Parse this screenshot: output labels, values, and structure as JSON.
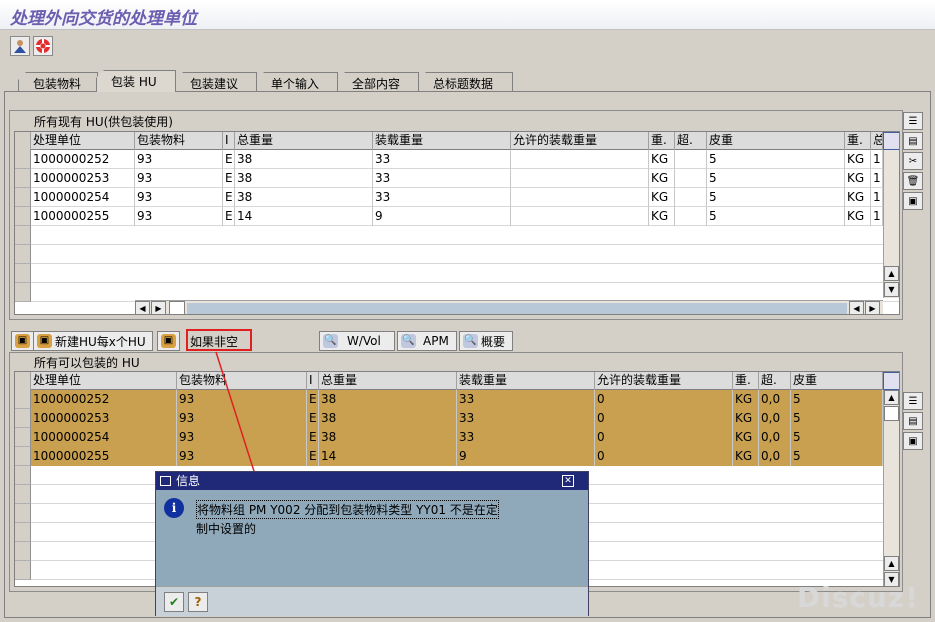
{
  "window": {
    "title": "处理外向交货的处理单位"
  },
  "toolbar": {
    "icons": [
      "user-icon",
      "help-lifebuoy-icon"
    ]
  },
  "tabs": [
    {
      "label": "包装物料"
    },
    {
      "label": "包装 HU"
    },
    {
      "label": "包装建议"
    },
    {
      "label": "单个输入"
    },
    {
      "label": "全部内容"
    },
    {
      "label": "总标题数据"
    }
  ],
  "upper_panel": {
    "title": "所有现有 HU(供包装使用)",
    "columns": [
      "处理单位",
      "包装物料",
      "I",
      "总重量",
      "装载重量",
      "允许的装载重量",
      "重.",
      "超.",
      "皮重",
      "重.",
      "总"
    ],
    "rows": [
      [
        "1000000252",
        "93",
        "E",
        "38",
        "33",
        "",
        "KG",
        "",
        "5",
        "KG",
        "1"
      ],
      [
        "1000000253",
        "93",
        "E",
        "38",
        "33",
        "",
        "KG",
        "",
        "5",
        "KG",
        "1"
      ],
      [
        "1000000254",
        "93",
        "E",
        "38",
        "33",
        "",
        "KG",
        "",
        "5",
        "KG",
        "1"
      ],
      [
        "1000000255",
        "93",
        "E",
        "14",
        "9",
        "",
        "KG",
        "",
        "5",
        "KG",
        "1"
      ]
    ]
  },
  "actions": {
    "new_hu": "新建HU每x个HU",
    "if_empty": "如果非空",
    "wvol": "W/Vol",
    "apm": "APM",
    "summary": "概要"
  },
  "lower_panel": {
    "title": "所有可以包装的 HU",
    "columns": [
      "处理单位",
      "包装物料",
      "I",
      "总重量",
      "装载重量",
      "允许的装载重量",
      "重.",
      "超.",
      "皮重"
    ],
    "rows": [
      [
        "1000000252",
        "93",
        "E",
        "38",
        "33",
        "0",
        "KG",
        "0,0",
        "5"
      ],
      [
        "1000000253",
        "93",
        "E",
        "38",
        "33",
        "0",
        "KG",
        "0,0",
        "5"
      ],
      [
        "1000000254",
        "93",
        "E",
        "38",
        "33",
        "0",
        "KG",
        "0,0",
        "5"
      ],
      [
        "1000000255",
        "93",
        "E",
        "14",
        "9",
        "0",
        "KG",
        "0,0",
        "5"
      ]
    ]
  },
  "dialog": {
    "title": "信息",
    "message_line1": "将物料组 PM Y002 分配到包装物料类型 YY01 不是在定",
    "message_line2": "制中设置的"
  },
  "watermark": "Discuz!",
  "colors": {
    "highlight_row": "#c8a050",
    "dialog_header": "#202878",
    "dialog_body": "#8fa9ba",
    "title_text": "#6b5db0",
    "callout": "#e02020"
  }
}
